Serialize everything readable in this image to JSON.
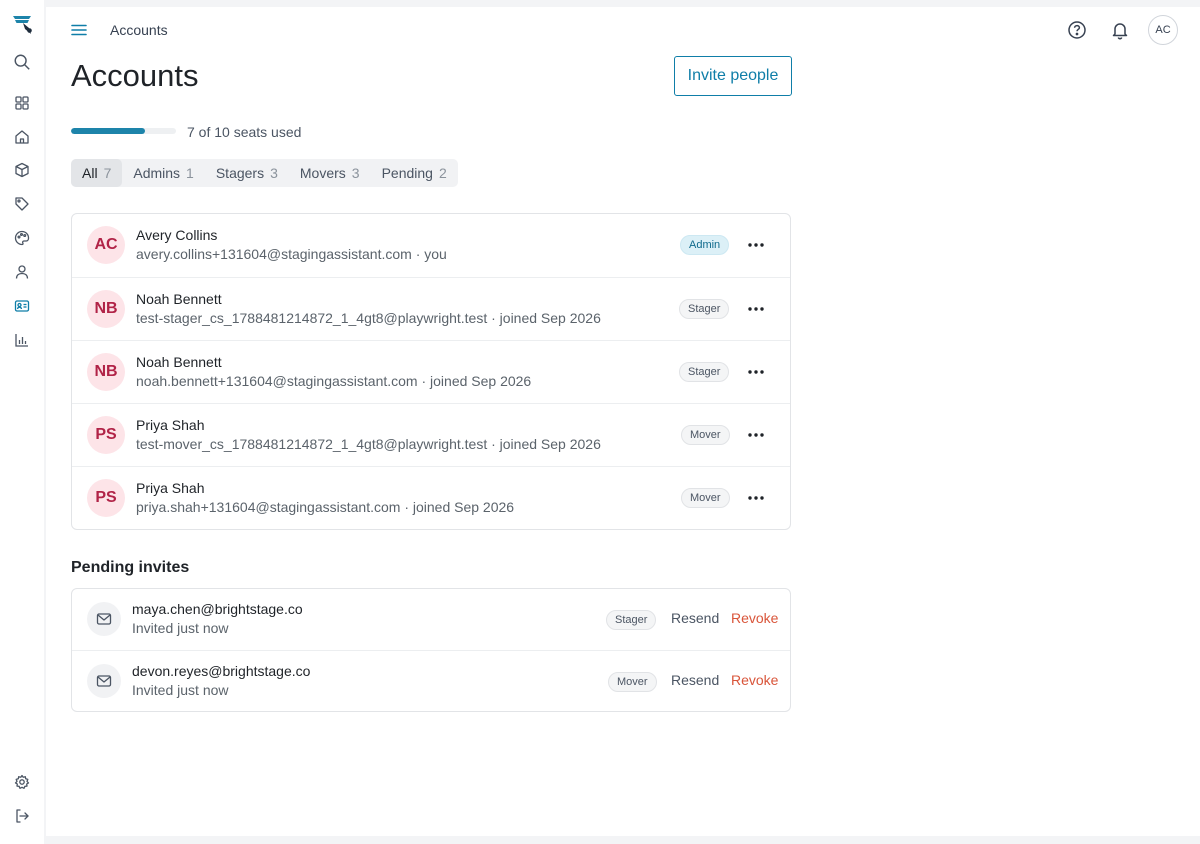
{
  "breadcrumb": "Accounts",
  "page_title": "Accounts",
  "invite_button": "Invite people",
  "user_initials": "AC",
  "seats": {
    "text": "7 of 10 seats used",
    "used": 7,
    "total": 10
  },
  "filters": [
    {
      "label": "All",
      "count": "7"
    },
    {
      "label": "Admins",
      "count": "1"
    },
    {
      "label": "Stagers",
      "count": "3"
    },
    {
      "label": "Movers",
      "count": "3"
    },
    {
      "label": "Pending",
      "count": "2"
    }
  ],
  "members": [
    {
      "initials": "AC",
      "name": "Avery Collins",
      "sub": "avery.collins+131604@stagingassistant.com · you",
      "role": "Admin"
    },
    {
      "initials": "NB",
      "name": "Noah Bennett",
      "sub": "test-stager_cs_1788481214872_1_4gt8@playwright.test · joined Sep 2026",
      "role": "Stager"
    },
    {
      "initials": "NB",
      "name": "Noah Bennett",
      "sub": "noah.bennett+131604@stagingassistant.com · joined Sep 2026",
      "role": "Stager"
    },
    {
      "initials": "PS",
      "name": "Priya Shah",
      "sub": "test-mover_cs_1788481214872_1_4gt8@playwright.test · joined Sep 2026",
      "role": "Mover"
    },
    {
      "initials": "PS",
      "name": "Priya Shah",
      "sub": "priya.shah+131604@stagingassistant.com · joined Sep 2026",
      "role": "Mover"
    }
  ],
  "pending_title": "Pending invites",
  "invites": [
    {
      "email": "maya.chen@brightstage.co",
      "sub": "Invited just now",
      "role": "Stager",
      "resend": "Resend",
      "revoke": "Revoke"
    },
    {
      "email": "devon.reyes@brightstage.co",
      "sub": "Invited just now",
      "role": "Mover",
      "resend": "Resend",
      "revoke": "Revoke"
    }
  ],
  "colors": {
    "accent": "#0f7ea8",
    "danger": "#d9553a",
    "avatar_bg": "#fde4e8",
    "avatar_text": "#b12347"
  },
  "icons": {
    "sidebar_top": [
      "logo-icon",
      "search-icon",
      "grid-icon",
      "home-icon",
      "box-icon",
      "tag-icon",
      "palette-icon",
      "user-icon",
      "id-card-icon",
      "bar-chart-icon"
    ],
    "sidebar_bottom": [
      "gear-icon",
      "logout-icon"
    ],
    "topbar": [
      "menu-icon",
      "help-icon",
      "bell-icon"
    ]
  }
}
